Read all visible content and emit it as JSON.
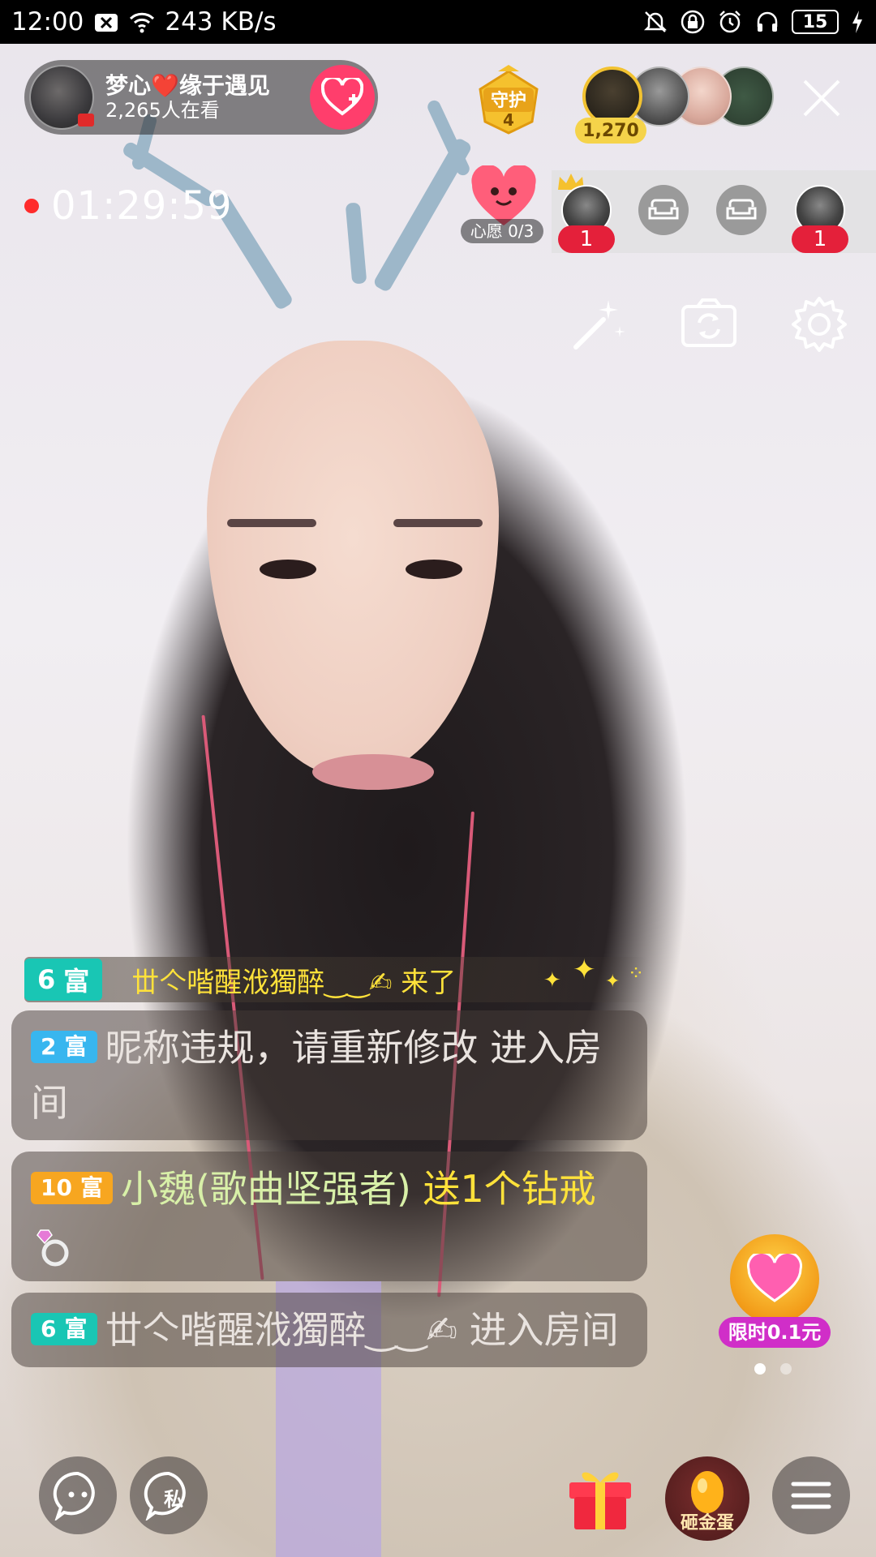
{
  "status_bar": {
    "time": "12:00",
    "net_speed": "243 KB/s",
    "battery": "15",
    "icons": [
      "sim-x-icon",
      "wifi-icon",
      "mute-icon",
      "lock-icon",
      "alarm-icon",
      "headphones-icon",
      "battery-icon",
      "charging-icon"
    ]
  },
  "host": {
    "name": "梦心❤️缘于遇见",
    "viewers": "2,265人在看"
  },
  "guard": {
    "label": "守护",
    "count": "4"
  },
  "top_viewer_score": "1,270",
  "live": {
    "timer": "01:29:59"
  },
  "wish": {
    "label": "心愿 0/3"
  },
  "seats": [
    {
      "type": "avatar",
      "count": "1"
    },
    {
      "type": "empty"
    },
    {
      "type": "empty"
    },
    {
      "type": "avatar",
      "count": "1"
    }
  ],
  "entry_banner": {
    "level": "6",
    "rank": "富",
    "text": "丗亽喈醒浌獨醉‿‿✍ 来了"
  },
  "chat": [
    {
      "level": "2",
      "rank": "富",
      "nick": "昵称违规，请重新修改",
      "action": " 进入房间"
    },
    {
      "level": "10",
      "rank": "富",
      "nick": "小魏(歌曲坚强者)",
      "action": " 送1个钻戒"
    },
    {
      "level": "6",
      "rank": "富",
      "nick": "丗亽喈醒浌獨醉‿‿✍",
      "action": " 进入房间"
    }
  ],
  "promo": {
    "label": "限时0.1元"
  },
  "bottom": {
    "egg_label": "砸金蛋"
  },
  "colors": {
    "accent_pink": "#ff3e6c",
    "badge_teal": "#19c6b4",
    "badge_blue": "#38b6ef",
    "badge_orange": "#f7a620",
    "gift_yellow": "#ffe23a",
    "live_red": "#ff2b2b"
  }
}
